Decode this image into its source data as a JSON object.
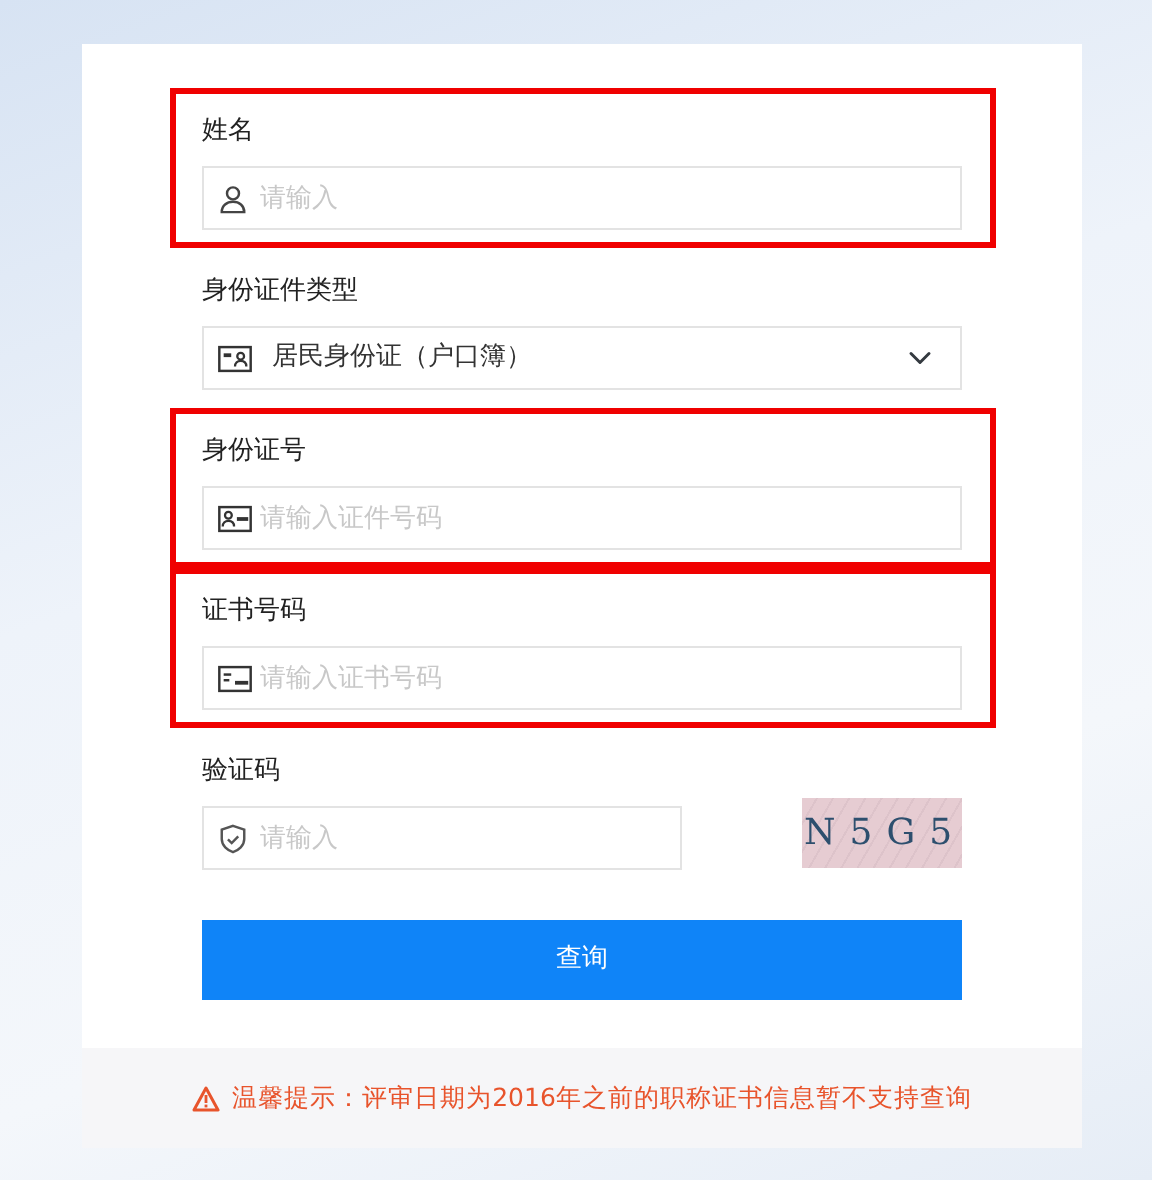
{
  "form": {
    "groups": [
      {
        "kind": "input",
        "label": "姓名",
        "placeholder": "请输入",
        "highlighted": true
      },
      {
        "kind": "select",
        "label": "身份证件类型",
        "value": "居民身份证（户口簿）",
        "highlighted": false
      },
      {
        "kind": "input",
        "label": "身份证号",
        "placeholder": "请输入证件号码",
        "highlighted": true
      },
      {
        "kind": "input",
        "label": "证书号码",
        "placeholder": "请输入证书号码",
        "highlighted": true
      },
      {
        "kind": "captcha",
        "label": "验证码",
        "placeholder": "请输入",
        "captcha": "N5G5",
        "highlighted": false
      }
    ],
    "submit": "查询"
  },
  "notice": "温馨提示：评审日期为2016年之前的职称证书信息暂不支持查询"
}
